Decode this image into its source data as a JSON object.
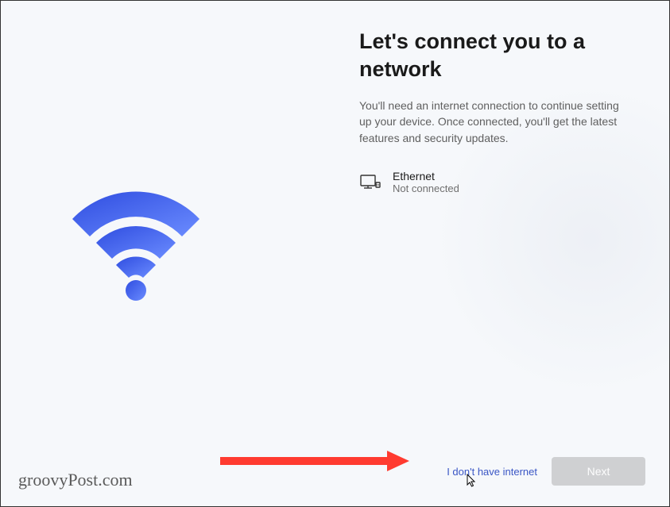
{
  "header": {
    "title": "Let's connect you to a network",
    "subtitle": "You'll need an internet connection to continue setting up your device. Once connected, you'll get the latest features and security updates."
  },
  "networks": [
    {
      "name": "Ethernet",
      "status": "Not connected",
      "icon": "ethernet-icon"
    }
  ],
  "actions": {
    "no_internet_label": "I don't have internet",
    "next_label": "Next"
  },
  "watermark": "groovyPost.com",
  "colors": {
    "accent_link": "#3a56c5",
    "wifi_gradient_start": "#3858e9",
    "wifi_gradient_end": "#6e8efb"
  }
}
